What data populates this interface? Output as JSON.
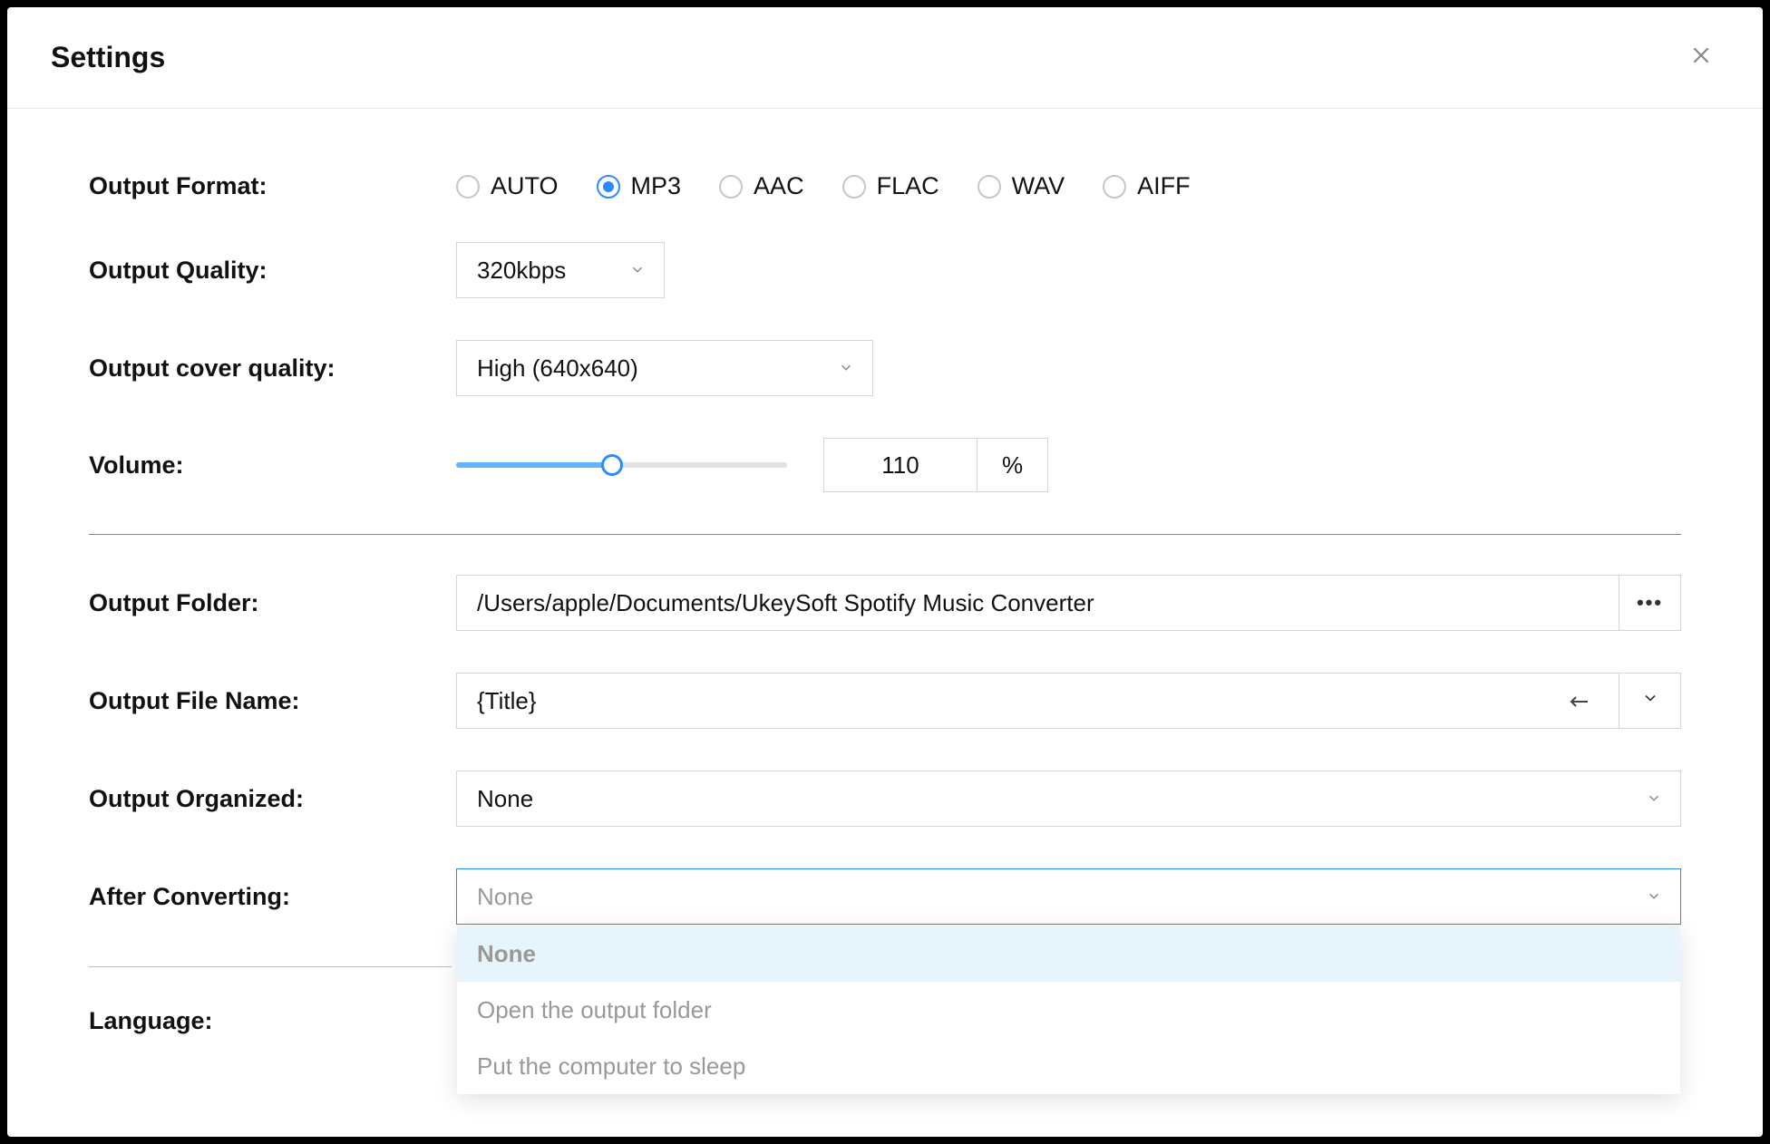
{
  "title": "Settings",
  "labels": {
    "output_format": "Output Format:",
    "output_quality": "Output Quality:",
    "output_cover_quality": "Output cover quality:",
    "volume": "Volume:",
    "output_folder": "Output Folder:",
    "output_file_name": "Output File Name:",
    "output_organized": "Output Organized:",
    "after_converting": "After Converting:",
    "language": "Language:"
  },
  "output_format": {
    "options": [
      "AUTO",
      "MP3",
      "AAC",
      "FLAC",
      "WAV",
      "AIFF"
    ],
    "selected": "MP3"
  },
  "output_quality": {
    "value": "320kbps"
  },
  "output_cover_quality": {
    "value": "High (640x640)"
  },
  "volume": {
    "value": "110",
    "unit": "%",
    "slider_percent": 47
  },
  "output_folder": {
    "value": "/Users/apple/Documents/UkeySoft Spotify Music Converter"
  },
  "output_file_name": {
    "value": "{Title}"
  },
  "output_organized": {
    "value": "None"
  },
  "after_converting": {
    "placeholder": "None",
    "options": [
      "None",
      "Open the output folder",
      "Put the computer to sleep"
    ],
    "highlighted": "None"
  }
}
